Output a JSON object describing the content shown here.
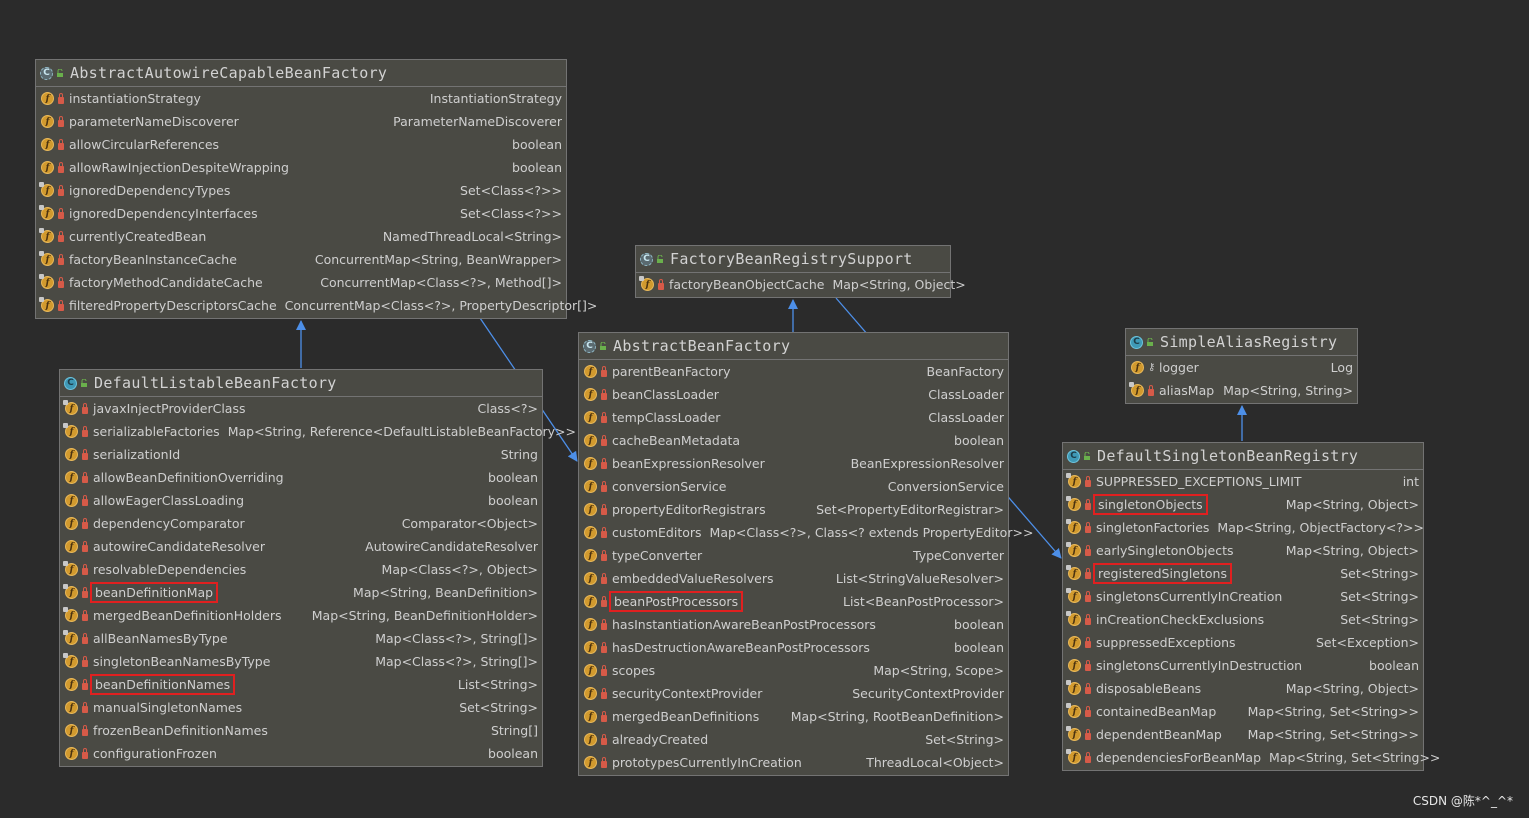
{
  "classes": [
    {
      "id": "aacbf",
      "title": "AbstractAutowireCapableBeanFactory",
      "abstract": true,
      "fields": [
        {
          "name": "instantiationStrategy",
          "type": "InstantiationStrategy"
        },
        {
          "name": "parameterNameDiscoverer",
          "type": "ParameterNameDiscoverer"
        },
        {
          "name": "allowCircularReferences",
          "type": "boolean"
        },
        {
          "name": "allowRawInjectionDespiteWrapping",
          "type": "boolean"
        },
        {
          "name": "ignoredDependencyTypes",
          "type": "Set<Class<?>>",
          "static": true
        },
        {
          "name": "ignoredDependencyInterfaces",
          "type": "Set<Class<?>>",
          "static": true
        },
        {
          "name": "currentlyCreatedBean",
          "type": "NamedThreadLocal<String>",
          "static": true
        },
        {
          "name": "factoryBeanInstanceCache",
          "type": "ConcurrentMap<String, BeanWrapper>",
          "static": true
        },
        {
          "name": "factoryMethodCandidateCache",
          "type": "ConcurrentMap<Class<?>, Method[]>",
          "static": true
        },
        {
          "name": "filteredPropertyDescriptorsCache",
          "type": "ConcurrentMap<Class<?>, PropertyDescriptor[]>",
          "static": true
        }
      ]
    },
    {
      "id": "dlbf",
      "title": "DefaultListableBeanFactory",
      "abstract": false,
      "fields": [
        {
          "name": "javaxInjectProviderClass",
          "type": "Class<?>",
          "static": true
        },
        {
          "name": "serializableFactories",
          "type": "Map<String, Reference<DefaultListableBeanFactory>>",
          "static": true
        },
        {
          "name": "serializationId",
          "type": "String"
        },
        {
          "name": "allowBeanDefinitionOverriding",
          "type": "boolean"
        },
        {
          "name": "allowEagerClassLoading",
          "type": "boolean"
        },
        {
          "name": "dependencyComparator",
          "type": "Comparator<Object>"
        },
        {
          "name": "autowireCandidateResolver",
          "type": "AutowireCandidateResolver"
        },
        {
          "name": "resolvableDependencies",
          "type": "Map<Class<?>, Object>",
          "static": true
        },
        {
          "name": "beanDefinitionMap",
          "type": "Map<String, BeanDefinition>",
          "static": true,
          "highlight": true
        },
        {
          "name": "mergedBeanDefinitionHolders",
          "type": "Map<String, BeanDefinitionHolder>",
          "static": true
        },
        {
          "name": "allBeanNamesByType",
          "type": "Map<Class<?>, String[]>",
          "static": true
        },
        {
          "name": "singletonBeanNamesByType",
          "type": "Map<Class<?>, String[]>",
          "static": true
        },
        {
          "name": "beanDefinitionNames",
          "type": "List<String>",
          "highlight": true
        },
        {
          "name": "manualSingletonNames",
          "type": "Set<String>"
        },
        {
          "name": "frozenBeanDefinitionNames",
          "type": "String[]"
        },
        {
          "name": "configurationFrozen",
          "type": "boolean"
        }
      ]
    },
    {
      "id": "fbrs",
      "title": "FactoryBeanRegistrySupport",
      "abstract": true,
      "fields": [
        {
          "name": "factoryBeanObjectCache",
          "type": "Map<String, Object>",
          "static": true
        }
      ]
    },
    {
      "id": "abf",
      "title": "AbstractBeanFactory",
      "abstract": true,
      "fields": [
        {
          "name": "parentBeanFactory",
          "type": "BeanFactory"
        },
        {
          "name": "beanClassLoader",
          "type": "ClassLoader"
        },
        {
          "name": "tempClassLoader",
          "type": "ClassLoader"
        },
        {
          "name": "cacheBeanMetadata",
          "type": "boolean"
        },
        {
          "name": "beanExpressionResolver",
          "type": "BeanExpressionResolver"
        },
        {
          "name": "conversionService",
          "type": "ConversionService"
        },
        {
          "name": "propertyEditorRegistrars",
          "type": "Set<PropertyEditorRegistrar>"
        },
        {
          "name": "customEditors",
          "type": "Map<Class<?>, Class<? extends PropertyEditor>>"
        },
        {
          "name": "typeConverter",
          "type": "TypeConverter"
        },
        {
          "name": "embeddedValueResolvers",
          "type": "List<StringValueResolver>"
        },
        {
          "name": "beanPostProcessors",
          "type": "List<BeanPostProcessor>",
          "highlight": true
        },
        {
          "name": "hasInstantiationAwareBeanPostProcessors",
          "type": "boolean"
        },
        {
          "name": "hasDestructionAwareBeanPostProcessors",
          "type": "boolean"
        },
        {
          "name": "scopes",
          "type": "Map<String, Scope>"
        },
        {
          "name": "securityContextProvider",
          "type": "SecurityContextProvider"
        },
        {
          "name": "mergedBeanDefinitions",
          "type": "Map<String, RootBeanDefinition>"
        },
        {
          "name": "alreadyCreated",
          "type": "Set<String>"
        },
        {
          "name": "prototypesCurrentlyInCreation",
          "type": "ThreadLocal<Object>"
        }
      ]
    },
    {
      "id": "sar",
      "title": "SimpleAliasRegistry",
      "abstract": false,
      "fields": [
        {
          "name": "logger",
          "type": "Log",
          "access": "key"
        },
        {
          "name": "aliasMap",
          "type": "Map<String, String>",
          "static": true
        }
      ]
    },
    {
      "id": "dsbr",
      "title": "DefaultSingletonBeanRegistry",
      "abstract": false,
      "fields": [
        {
          "name": "SUPPRESSED_EXCEPTIONS_LIMIT",
          "type": "int",
          "static": true
        },
        {
          "name": "singletonObjects",
          "type": "Map<String, Object>",
          "static": true,
          "highlight": true
        },
        {
          "name": "singletonFactories",
          "type": "Map<String, ObjectFactory<?>>",
          "static": true
        },
        {
          "name": "earlySingletonObjects",
          "type": "Map<String, Object>",
          "static": true
        },
        {
          "name": "registeredSingletons",
          "type": "Set<String>",
          "static": true,
          "highlight": true
        },
        {
          "name": "singletonsCurrentlyInCreation",
          "type": "Set<String>",
          "static": true
        },
        {
          "name": "inCreationCheckExclusions",
          "type": "Set<String>",
          "static": true
        },
        {
          "name": "suppressedExceptions",
          "type": "Set<Exception>"
        },
        {
          "name": "singletonsCurrentlyInDestruction",
          "type": "boolean"
        },
        {
          "name": "disposableBeans",
          "type": "Map<String, Object>",
          "static": true
        },
        {
          "name": "containedBeanMap",
          "type": "Map<String, Set<String>>",
          "static": true
        },
        {
          "name": "dependentBeanMap",
          "type": "Map<String, Set<String>>",
          "static": true
        },
        {
          "name": "dependenciesForBeanMap",
          "type": "Map<String, Set<String>>",
          "static": true
        }
      ]
    }
  ],
  "relations": [
    {
      "from": "dlbf",
      "to": "aacbf",
      "kind": "extends"
    },
    {
      "from": "aacbf",
      "to": "abf",
      "kind": "extends"
    },
    {
      "from": "abf",
      "to": "fbrs",
      "kind": "extends"
    },
    {
      "from": "fbrs",
      "to": "dsbr",
      "kind": "extends"
    },
    {
      "from": "dsbr",
      "to": "sar",
      "kind": "extends"
    }
  ],
  "colors": {
    "background": "#2b2b2b",
    "box": "#4a4a44",
    "arrow": "#4d8fe8",
    "highlight": "#e02020"
  },
  "watermark": "CSDN @陈*^_^*"
}
